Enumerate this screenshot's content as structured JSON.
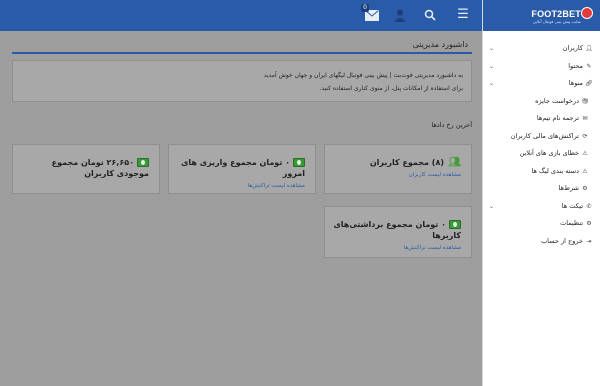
{
  "topbar": {
    "icons": [
      "hamburger-menu-icon",
      "search-icon",
      "user-icon",
      "mail-icon"
    ],
    "mail_badge": "0"
  },
  "sidebar": {
    "logo_text": "FOOT2BET",
    "logo_tagline": "سایت پیش بینی فوتبال آنلاین",
    "items": [
      {
        "label": "کاربران",
        "icon": "user-icon",
        "chevron": true
      },
      {
        "label": "محتوا",
        "icon": "pencil-icon",
        "chevron": true
      },
      {
        "label": "منوها",
        "icon": "link-icon",
        "chevron": true
      },
      {
        "label": "درخواست جایزه",
        "icon": "gift-icon",
        "sub": true
      },
      {
        "label": "ترجمه نام تیم‌ها",
        "icon": "envelope-icon",
        "sub": true
      },
      {
        "label": "تراکنش‌های مالی کاربران",
        "icon": "refresh-icon",
        "sub": true
      },
      {
        "label": "خطای بازی های آنلاین",
        "icon": "warning-icon",
        "sub": true
      },
      {
        "label": "دسته بندی لیگ ها",
        "icon": "warning-icon",
        "sub": true
      },
      {
        "label": "شرط‌ها",
        "icon": "gear-icon",
        "sub": true
      },
      {
        "label": "تیکت ها",
        "icon": "ticket-icon",
        "chevron": true
      },
      {
        "label": "تنظیمات",
        "icon": "gears-icon"
      },
      {
        "label": "خروج از حساب",
        "icon": "logout-icon"
      }
    ]
  },
  "main": {
    "title": "داشبورد مدیریتی",
    "welcome_line1": "به داشبورد مدیریتی فوت‌بت | پیش بینی فوتبال لیگهای ایران و جهان خوش آمدید",
    "welcome_line2": "برای استفاده از امکانات پنل، از منوی کناری استفاده کنید.",
    "section_title": "آخرین رخ دادها",
    "cards": [
      {
        "value": "(۸) مجموع کاربران",
        "link": "مشاهده لیست کاربران",
        "icon": "users-icon"
      },
      {
        "value": "۰ تومان مجموع واریزی های امروز",
        "link": "مشاهده لیست تراکنش‌ها",
        "icon": "money-icon"
      },
      {
        "value": "۲۶,۶۵۰ تومان مجموع موجودی کاربران",
        "link": "",
        "icon": "money-icon"
      },
      {
        "value": "۰ تومان مجموع برداشتی‌های کاربرها",
        "link": "مشاهده لیست تراکنش‌ها",
        "icon": "money-icon"
      }
    ]
  }
}
